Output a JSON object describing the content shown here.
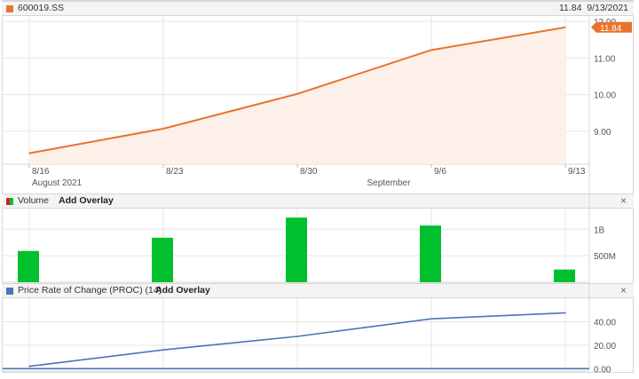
{
  "header": {
    "symbol": "600019.SS",
    "last_price": "11.84",
    "last_date": "9/13/2021"
  },
  "colors": {
    "price": "#e8732c",
    "price_fill": "#fdf0e8",
    "volume": "#00c02e",
    "proc": "#4c74b9",
    "grid": "#e6e6e6"
  },
  "panels": {
    "volume": {
      "label": "Volume",
      "overlay": "Add Overlay",
      "close": "×"
    },
    "proc": {
      "label": "Price Rate of Change (PROC) (14)",
      "overlay": "Add Overlay",
      "close": "×"
    }
  },
  "chart_data": [
    {
      "type": "area",
      "x": [
        "8/16",
        "8/23",
        "8/30",
        "9/6",
        "9/13"
      ],
      "values": [
        8.4,
        9.07,
        10.02,
        11.22,
        11.84
      ],
      "ylim": [
        8.1,
        12.15
      ],
      "yticks": [
        9.0,
        10.0,
        11.0,
        12.0
      ],
      "ytick_labels": [
        "9.00",
        "10.00",
        "11.00",
        "12.00"
      ],
      "xtick_labels": [
        "8/16",
        "8/23",
        "8/30",
        "9/6",
        "9/13"
      ],
      "month_labels": [
        {
          "label": "August 2021",
          "at": 0
        },
        {
          "label": "September",
          "at": 2.5
        }
      ],
      "last_value_label": "11.84"
    },
    {
      "type": "bar",
      "x": [
        "8/16",
        "8/23",
        "8/30",
        "9/6",
        "9/13"
      ],
      "values": [
        590000000,
        840000000,
        1220000000,
        1070000000,
        240000000
      ],
      "ylim": [
        0,
        1390000000
      ],
      "yticks": [
        500000000,
        1000000000
      ],
      "ytick_labels": [
        "500M",
        "1B"
      ]
    },
    {
      "type": "line",
      "x": [
        "8/16",
        "8/23",
        "8/30",
        "9/6",
        "9/13"
      ],
      "values": [
        2.0,
        16.0,
        27.5,
        42.5,
        47.5
      ],
      "baseline": 0,
      "ylim": [
        -2,
        60
      ],
      "yticks": [
        0,
        20,
        40
      ],
      "ytick_labels": [
        "0.00",
        "20.00",
        "40.00"
      ]
    }
  ]
}
